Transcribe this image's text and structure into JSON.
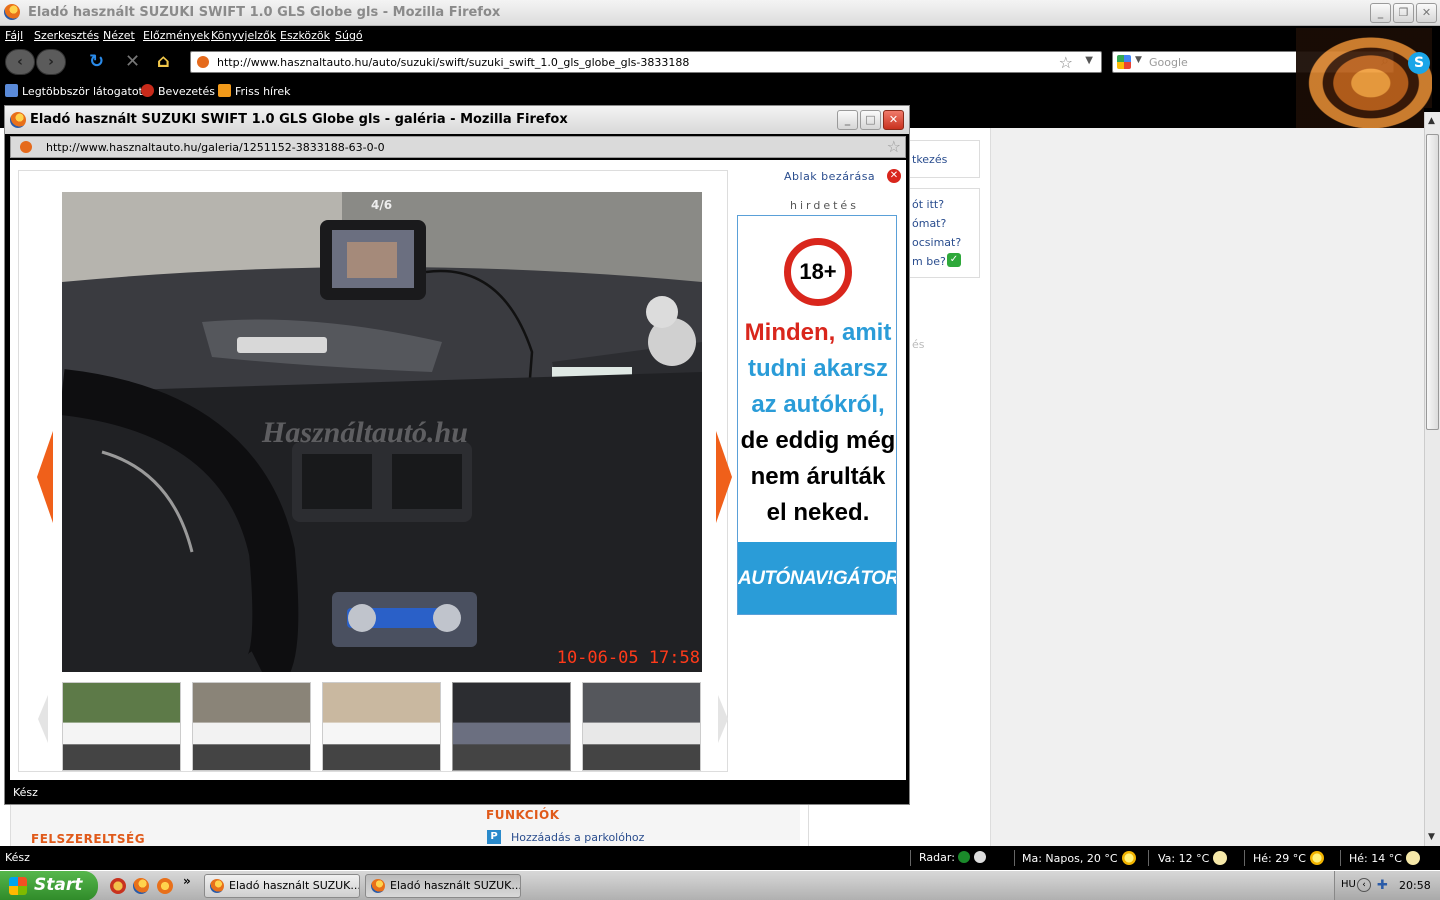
{
  "main_window": {
    "title": "Eladó használt SUZUKI SWIFT 1.0 GLS Globe gls - Mozilla Firefox",
    "menu": [
      "Fájl",
      "Szerkesztés",
      "Nézet",
      "Előzmények",
      "Könyvjelzők",
      "Eszközök",
      "Súgó"
    ],
    "url": "http://www.hasznaltauto.hu/auto/suzuki/swift/suzuki_swift_1.0_gls_globe_gls-3833188",
    "search_placeholder": "Google",
    "bookmarks": [
      "Legtöbbször látogatott",
      "Bevezetés",
      "Friss hírek"
    ],
    "status": "Kész"
  },
  "page": {
    "sidebar_links": [
      "tkezés",
      "ót itt?",
      "ómat?",
      "ocsimat?",
      "m be?"
    ],
    "faded_text": "és",
    "felszereltseg": "FELSZERELTSÉG",
    "funkciok": "FUNKCIÓK",
    "parking_icon": "P",
    "parking_link": "Hozzáadás a parkolóhoz"
  },
  "popup": {
    "title": "Eladó használt SUZUKI SWIFT 1.0 GLS Globe gls - galéria - Mozilla Firefox",
    "url": "http://www.hasznaltauto.hu/galeria/1251152-3833188-63-0-0",
    "status": "Kész",
    "close_link": "Ablak bezárása",
    "ad_label": "hirdetés",
    "photo_counter": "4/6",
    "photo_date": "10-06-05 17:58",
    "photo_watermark": "Használtautó.hu",
    "thumb_count": 5,
    "selected_thumb": 4
  },
  "ad": {
    "badge": "18+",
    "lines": [
      {
        "text": "Minden,",
        "accent": " amit",
        "color": "#d9261c",
        "accent_color": "#2a9cd8"
      },
      {
        "text": "tudni akarsz",
        "color": "#2a9cd8"
      },
      {
        "text": "az autókról,",
        "color": "#2a9cd8"
      },
      {
        "text": "de eddig még",
        "color": "#000000"
      },
      {
        "text": "nem árulták",
        "color": "#000000"
      },
      {
        "text": "el neked.",
        "color": "#000000"
      }
    ],
    "brand": "AUTÓNAV!GÁTOR"
  },
  "weather": {
    "radar": "Radar:",
    "today": "Ma: Napos, 20 °C",
    "sunday": "Va: 12 °C",
    "monday": "Hé: 29 °C",
    "monday2": "Hé: 14 °C"
  },
  "taskbar": {
    "start": "Start",
    "tasks": [
      "Eladó használt SUZUK...",
      "Eladó használt SUZUK..."
    ],
    "lang": "HU",
    "clock": "20:58"
  },
  "colors": {
    "accent_orange": "#e05a1a",
    "link_blue": "#2a4d8e",
    "ad_blue": "#2a9cd8",
    "ad_red": "#d9261c"
  }
}
